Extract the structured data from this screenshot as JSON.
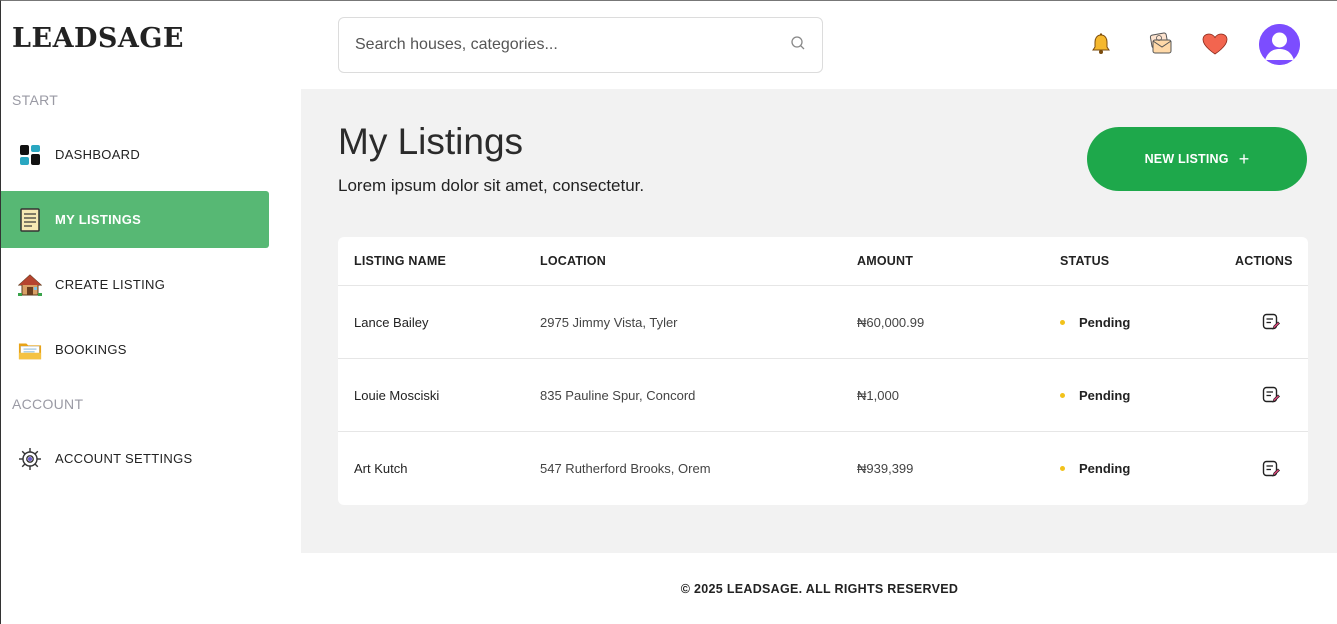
{
  "brand": {
    "logo": "LEADSAGE"
  },
  "sidebar": {
    "sections": [
      {
        "label": "START"
      },
      {
        "label": "ACCOUNT"
      }
    ],
    "items": [
      {
        "label": "DASHBOARD",
        "icon": "dashboard-icon"
      },
      {
        "label": "MY LISTINGS",
        "icon": "listings-icon",
        "active": true
      },
      {
        "label": "CREATE LISTING",
        "icon": "house-icon"
      },
      {
        "label": "BOOKINGS",
        "icon": "folder-icon"
      },
      {
        "label": "ACCOUNT SETTINGS",
        "icon": "gear-icon"
      }
    ]
  },
  "header": {
    "search": {
      "placeholder": "Search houses, categories..."
    },
    "icons": [
      "bell-icon",
      "messages-icon",
      "heart-icon",
      "avatar"
    ]
  },
  "main": {
    "title": "My Listings",
    "subtitle": "Lorem ipsum dolor sit amet, consectetur.",
    "new_listing_label": "NEW LISTING",
    "new_listing_plus": "+",
    "table": {
      "headers": [
        "LISTING NAME",
        "LOCATION",
        "AMOUNT",
        "STATUS",
        "ACTIONS"
      ],
      "rows": [
        {
          "name": "Lance Bailey",
          "location": "2975 Jimmy Vista, Tyler",
          "amount": "₦60,000.99",
          "status": "Pending"
        },
        {
          "name": "Louie Mosciski",
          "location": "835 Pauline Spur, Concord",
          "amount": "₦1,000",
          "status": "Pending"
        },
        {
          "name": "Art Kutch",
          "location": "547 Rutherford Brooks, Orem",
          "amount": "₦939,399",
          "status": "Pending"
        }
      ]
    }
  },
  "colors": {
    "accent": "#1ea84b",
    "active_nav": "#57b874",
    "status_pending": "#f2c21b",
    "avatar": "#7c4dff"
  },
  "footer": {
    "text": "© 2025 LEADSAGE. ALL RIGHTS RESERVED"
  }
}
